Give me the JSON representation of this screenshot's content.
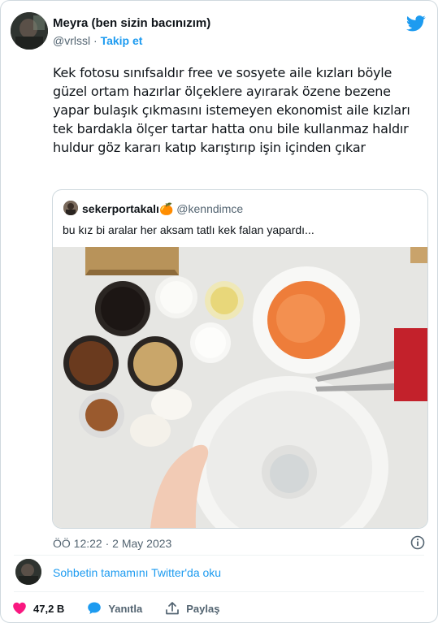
{
  "tweet": {
    "author_name": "Meyra (ben sizin bacınızım)",
    "author_handle": "@vrlssl",
    "separator": "·",
    "follow_label": "Takip et",
    "text": "Kek fotosu sınıfsaldır free ve sosyete aile kızları böyle güzel ortam hazırlar ölçeklere ayırarak özene bezene yapar bulaşık çıkmasını istemeyen ekonomist aile kızları tek bardakla ölçer tartar hatta onu bile kullanmaz haldır huldur göz kararı katıp karıştırıp işin içinden çıkar",
    "timestamp": "ÖÖ 12:22 · 2 May 2023"
  },
  "quoted": {
    "author_name": "sekerportakalı🍊",
    "author_handle": "@kenndimce",
    "text": "bu kız bi aralar her aksam tatlı kek falan yapardı..."
  },
  "conversation": {
    "link_label": "Sohbetin tamamını Twitter'da oku"
  },
  "actions": {
    "likes": "47,2 B",
    "reply_label": "Yanıtla",
    "share_label": "Paylaş"
  },
  "icons": {
    "brand": "twitter-bird-icon",
    "info": "info-icon",
    "like": "heart-icon",
    "reply": "speech-bubble-icon",
    "share": "share-icon"
  },
  "colors": {
    "accent": "#1d9bf0",
    "like": "#f91880",
    "muted": "#536471",
    "border": "#cfd9de"
  }
}
